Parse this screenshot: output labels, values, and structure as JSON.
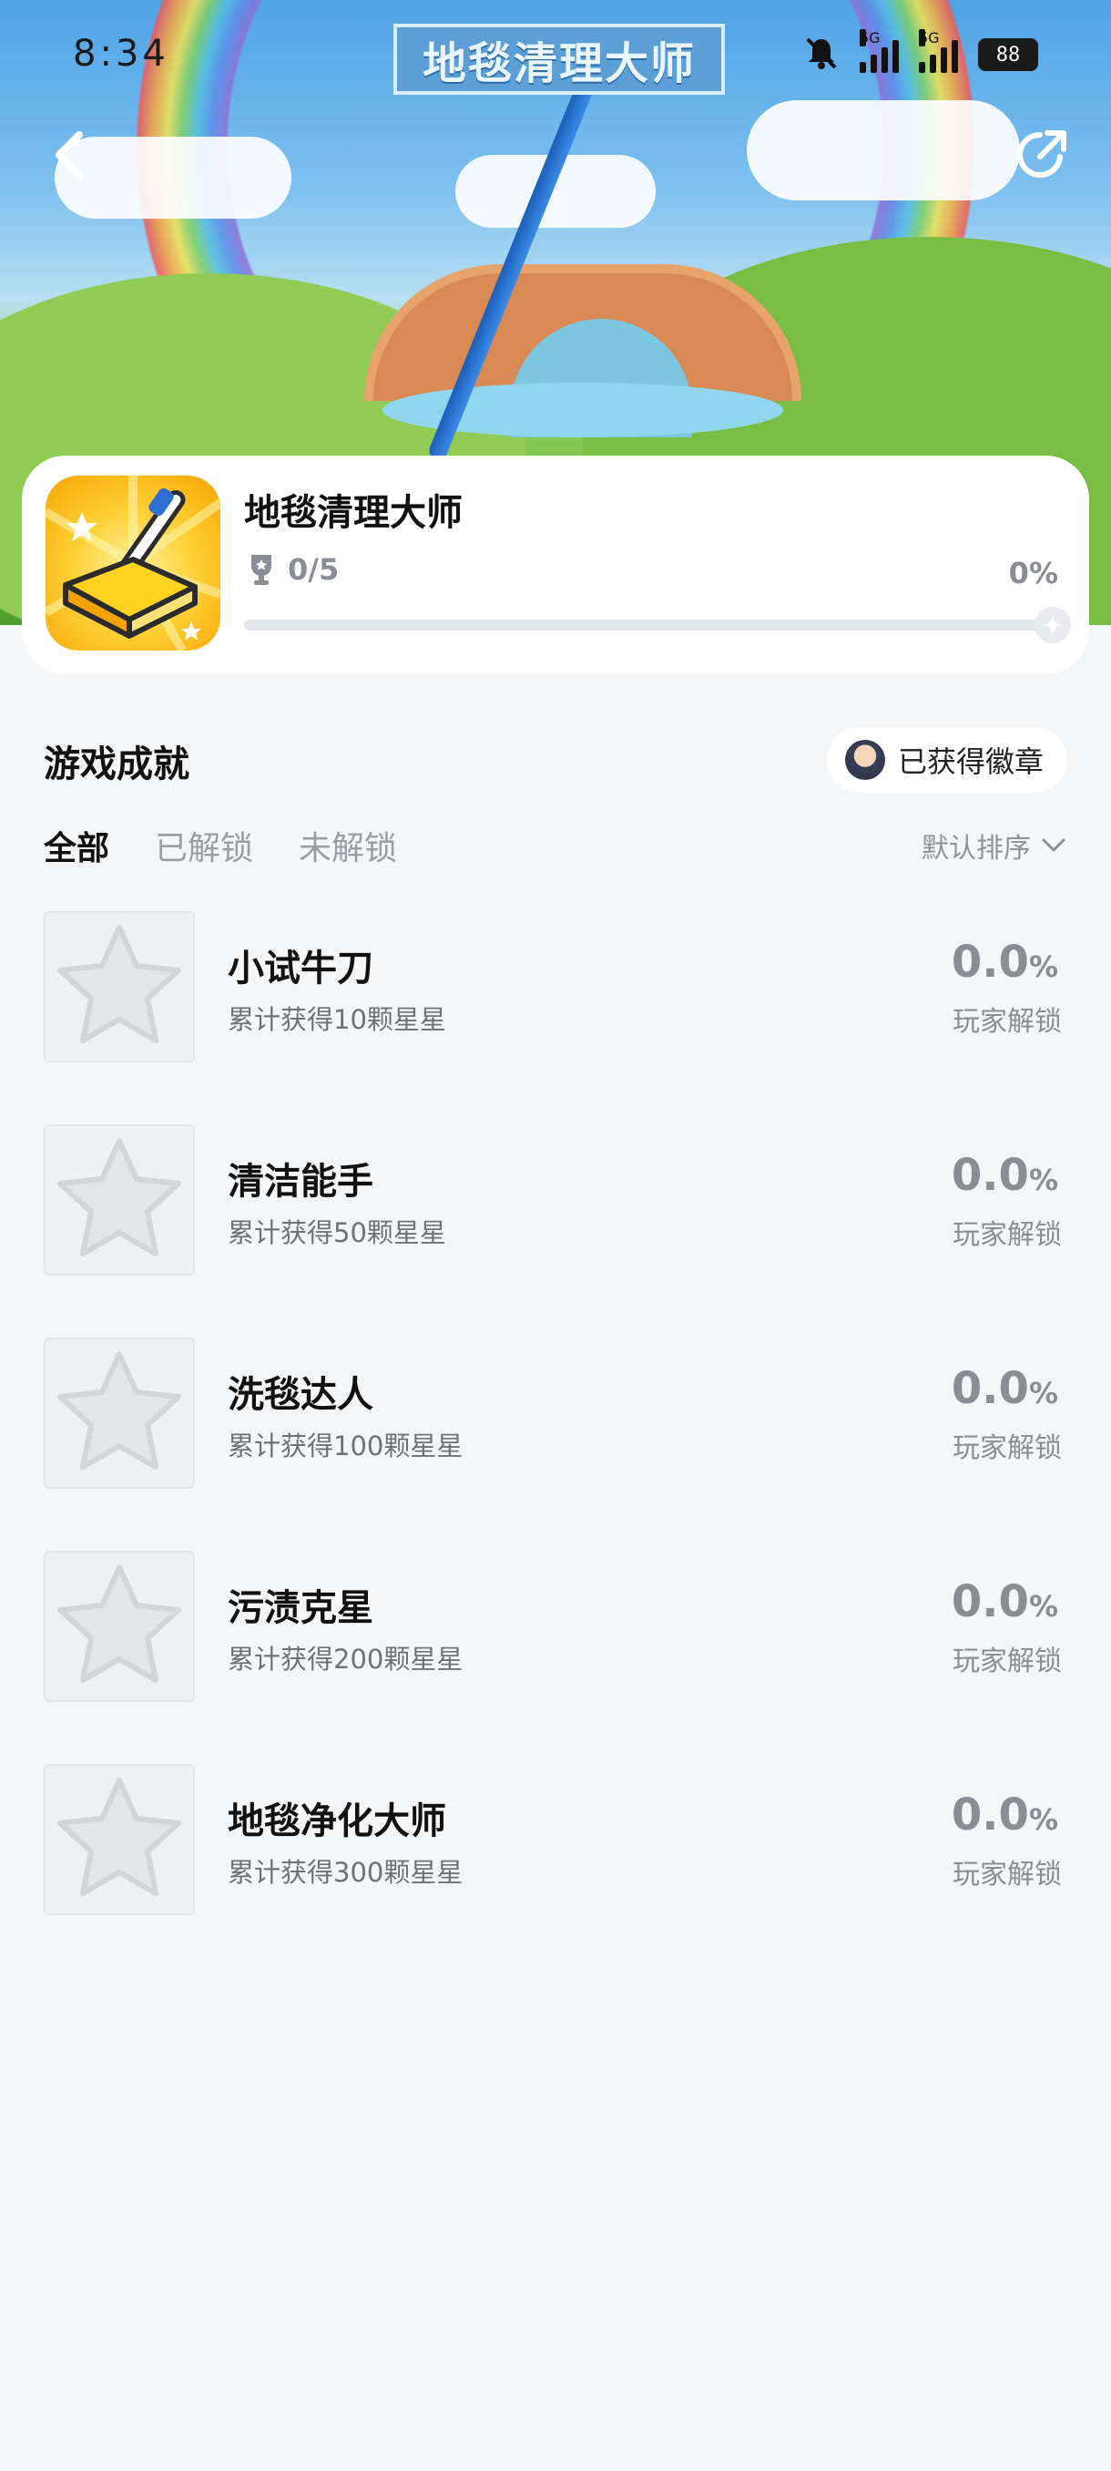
{
  "status_bar": {
    "time": "8:34",
    "signal_tag_1": "5G",
    "signal_tag_2": "5G",
    "battery": "88"
  },
  "hero": {
    "banner_title": "地毯清理大师"
  },
  "game": {
    "title": "地毯清理大师",
    "trophy_progress": "0/5",
    "percent": "0%",
    "progress_fraction": 0.0
  },
  "section": {
    "title": "游戏成就",
    "badge_label": "已获得徽章"
  },
  "tabs": [
    {
      "label": "全部",
      "active": true
    },
    {
      "label": "已解锁",
      "active": false
    },
    {
      "label": "未解锁",
      "active": false
    }
  ],
  "sort": {
    "label": "默认排序"
  },
  "achievements": [
    {
      "name": "小试牛刀",
      "desc": "累计获得10颗星星",
      "pct": "0.0",
      "unit": "%",
      "unlock_label": "玩家解锁"
    },
    {
      "name": "清洁能手",
      "desc": "累计获得50颗星星",
      "pct": "0.0",
      "unit": "%",
      "unlock_label": "玩家解锁"
    },
    {
      "name": "洗毯达人",
      "desc": "累计获得100颗星星",
      "pct": "0.0",
      "unit": "%",
      "unlock_label": "玩家解锁"
    },
    {
      "name": "污渍克星",
      "desc": "累计获得200颗星星",
      "pct": "0.0",
      "unit": "%",
      "unlock_label": "玩家解锁"
    },
    {
      "name": "地毯净化大师",
      "desc": "累计获得300颗星星",
      "pct": "0.0",
      "unit": "%",
      "unlock_label": "玩家解锁"
    }
  ],
  "colors": {
    "background": "#f5f6f8",
    "card": "#ffffff",
    "muted_text": "#8a8d93",
    "progress_fill": "#3a8ee6"
  }
}
